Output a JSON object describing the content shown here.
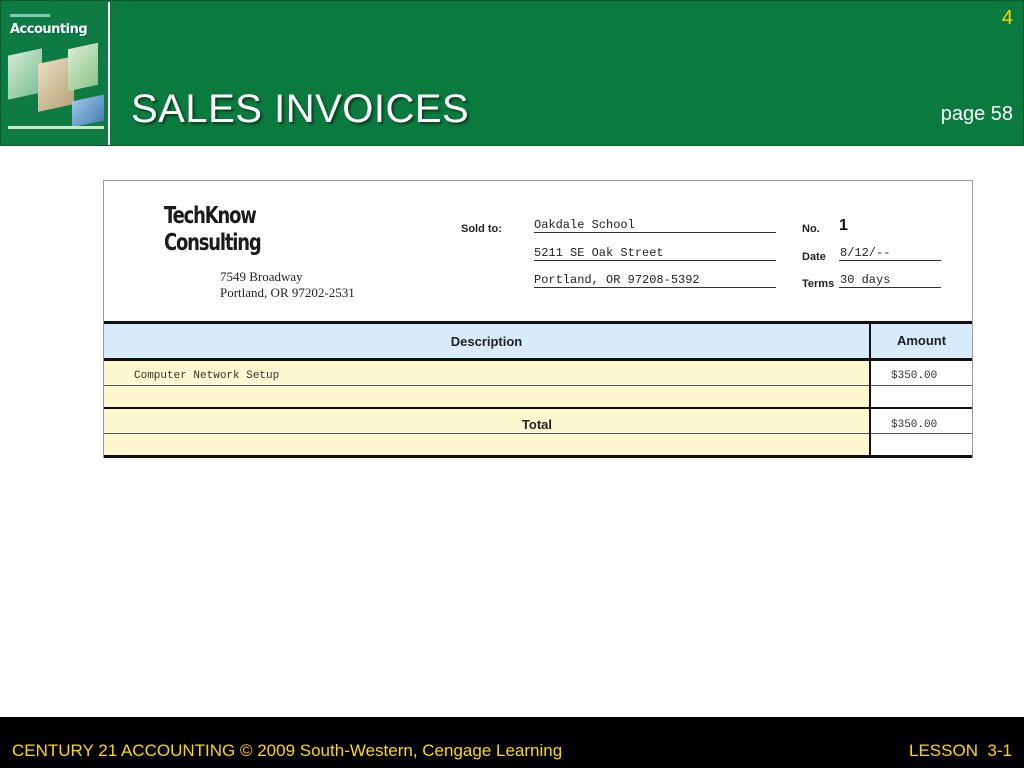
{
  "header": {
    "slide_number": "4",
    "title": "SALES INVOICES",
    "page_ref": "page 58",
    "cover_brand": "Accounting"
  },
  "invoice": {
    "company": {
      "name_line1": "TechKnow",
      "name_line2": "Consulting",
      "address_line1": "7549 Broadway",
      "address_line2": "Portland, OR 97202-2531"
    },
    "sold_to_label": "Sold to:",
    "sold_to": [
      "Oakdale School",
      "5211 SE Oak Street",
      "Portland, OR 97208-5392"
    ],
    "no_label": "No.",
    "no_value": "1",
    "date_label": "Date",
    "date_value": "8/12/--",
    "terms_label": "Terms",
    "terms_value": "30 days",
    "table": {
      "col_description": "Description",
      "col_amount": "Amount",
      "line_description": "Computer Network Setup",
      "line_amount": "$350.00",
      "total_label": "Total",
      "total_amount": "$350.00"
    }
  },
  "footer": {
    "left": "CENTURY 21 ACCOUNTING © 2009 South-Western, Cengage Learning",
    "right": "LESSON  3-1"
  },
  "colors": {
    "header_green": "#0a7a3e",
    "accent_yellow": "#ffd700",
    "table_header_blue": "#d7ebfb",
    "row_yellow": "#fdf8d0"
  }
}
